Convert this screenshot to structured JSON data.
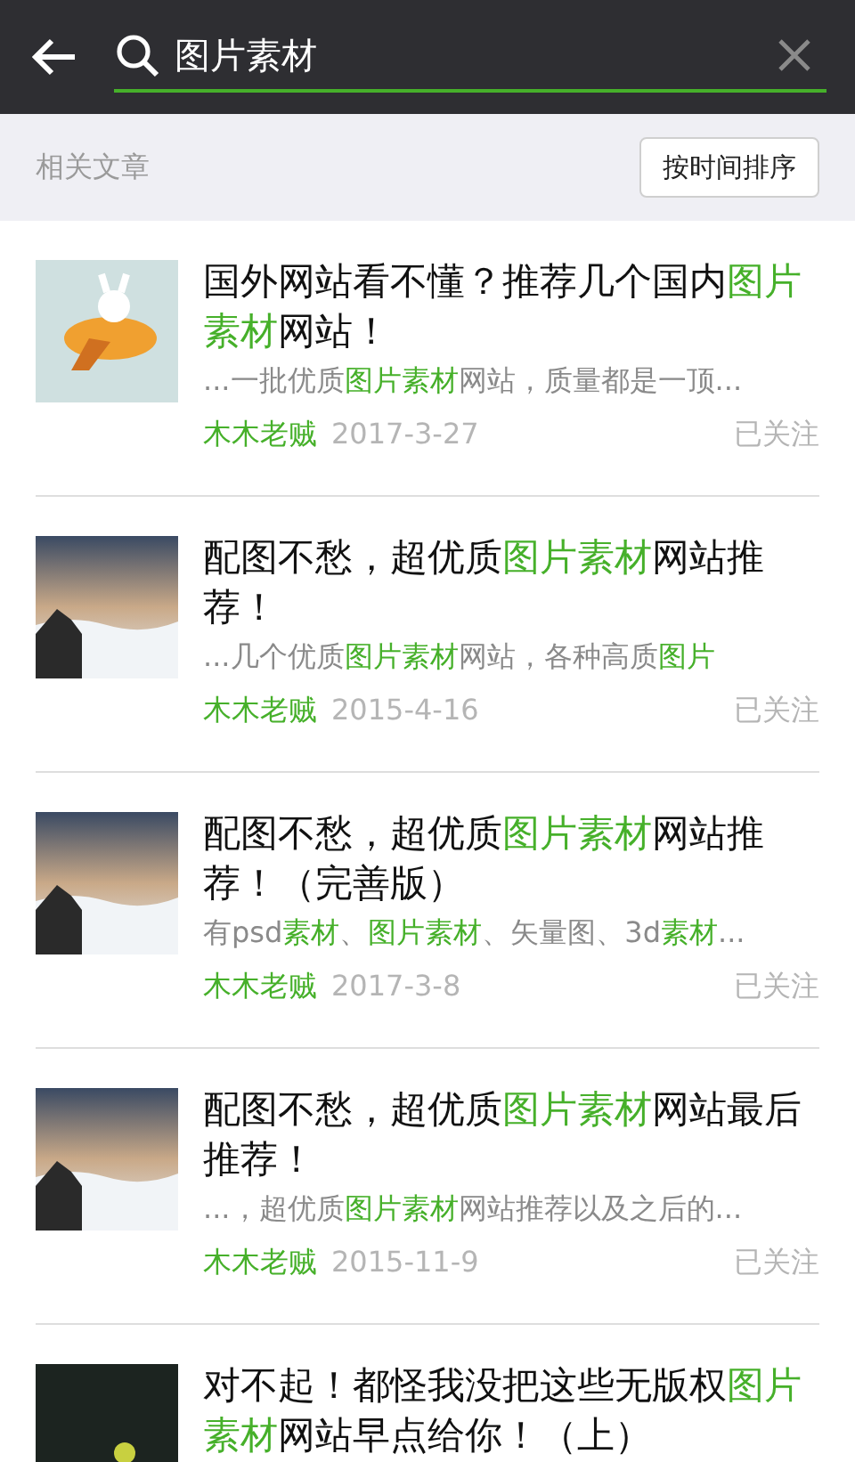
{
  "search": {
    "value": "图片素材"
  },
  "section_title": "相关文章",
  "sort_button": "按时间排序",
  "articles": [
    {
      "title": [
        {
          "text": "国外网站看不懂？推荐几个国内",
          "highlight": false
        },
        {
          "text": "图片素材",
          "highlight": true
        },
        {
          "text": "网站！",
          "highlight": false
        }
      ],
      "snippet": [
        {
          "text": "...一批优质",
          "highlight": false
        },
        {
          "text": "图片素材",
          "highlight": true
        },
        {
          "text": "网站，质量都是一顶...",
          "highlight": false
        }
      ],
      "author": "木木老贼",
      "date": "2017-3-27",
      "follow": "已关注",
      "kind": "cartoon"
    },
    {
      "title": [
        {
          "text": "配图不愁，超优质",
          "highlight": false
        },
        {
          "text": "图片素材",
          "highlight": true
        },
        {
          "text": "网站推荐！",
          "highlight": false
        }
      ],
      "snippet": [
        {
          "text": "...几个优质",
          "highlight": false
        },
        {
          "text": "图片素材",
          "highlight": true
        },
        {
          "text": "网站，各种高质",
          "highlight": false
        },
        {
          "text": "图片",
          "highlight": true
        }
      ],
      "author": "木木老贼",
      "date": "2015-4-16",
      "follow": "已关注",
      "kind": "photo"
    },
    {
      "title": [
        {
          "text": "配图不愁，超优质",
          "highlight": false
        },
        {
          "text": "图片素材",
          "highlight": true
        },
        {
          "text": "网站推荐！（完善版）",
          "highlight": false
        }
      ],
      "snippet": [
        {
          "text": "有psd",
          "highlight": false
        },
        {
          "text": "素材",
          "highlight": true
        },
        {
          "text": "、",
          "highlight": false
        },
        {
          "text": "图片素材",
          "highlight": true
        },
        {
          "text": "、矢量图、3d",
          "highlight": false
        },
        {
          "text": "素材",
          "highlight": true
        },
        {
          "text": "...",
          "highlight": false
        }
      ],
      "author": "木木老贼",
      "date": "2017-3-8",
      "follow": "已关注",
      "kind": "photo"
    },
    {
      "title": [
        {
          "text": "配图不愁，超优质",
          "highlight": false
        },
        {
          "text": "图片素材",
          "highlight": true
        },
        {
          "text": "网站最后推荐！",
          "highlight": false
        }
      ],
      "snippet": [
        {
          "text": "...，超优质",
          "highlight": false
        },
        {
          "text": "图片素材",
          "highlight": true
        },
        {
          "text": "网站推荐以及之后的...",
          "highlight": false
        }
      ],
      "author": "木木老贼",
      "date": "2015-11-9",
      "follow": "已关注",
      "kind": "photo"
    },
    {
      "title": [
        {
          "text": "对不起！都怪我没把这些无版权",
          "highlight": false
        },
        {
          "text": "图片素材",
          "highlight": true
        },
        {
          "text": "网站早点给你！（上）",
          "highlight": false
        }
      ],
      "kind": "dark"
    }
  ]
}
